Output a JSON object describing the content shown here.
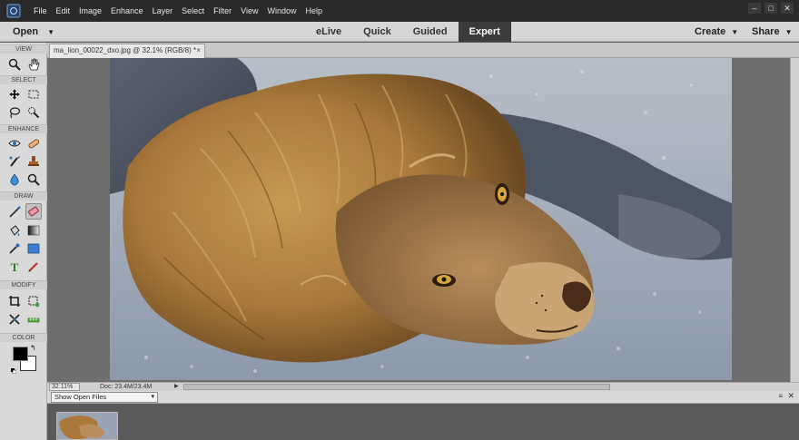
{
  "menubar": {
    "items": [
      "File",
      "Edit",
      "Image",
      "Enhance",
      "Layer",
      "Select",
      "Filter",
      "View",
      "Window",
      "Help"
    ],
    "logo_icon": "photoshop-elements-logo-icon",
    "window_controls": [
      "–",
      "□",
      "✕"
    ]
  },
  "modebar": {
    "open_label": "Open",
    "tabs": [
      "eLive",
      "Quick",
      "Guided",
      "Expert"
    ],
    "active_tab": "Expert",
    "create_label": "Create",
    "share_label": "Share"
  },
  "toolbox": {
    "sections": [
      "VIEW",
      "SELECT",
      "ENHANCE",
      "DRAW",
      "MODIFY",
      "COLOR"
    ],
    "tools": [
      "zoom-tool-icon",
      "hand-tool-icon",
      "move-tool-icon",
      "marquee-tool-icon",
      "lasso-tool-icon",
      "quick-selection-tool-icon",
      "red-eye-tool-icon",
      "spot-healing-tool-icon",
      "smart-brush-tool-icon",
      "clone-stamp-tool-icon",
      "blur-tool-icon",
      "sponge-tool-icon",
      "brush-tool-icon",
      "eraser-tool-icon",
      "paint-bucket-tool-icon",
      "gradient-tool-icon",
      "eyedropper-tool-icon",
      "shape-tool-icon",
      "type-tool-icon",
      "pencil-tool-icon",
      "crop-tool-icon",
      "recompose-tool-icon",
      "content-aware-move-tool-icon",
      "straighten-tool-icon"
    ],
    "selected_tool": "eraser-tool-icon",
    "foreground_color": "#000000",
    "background_color": "#ffffff"
  },
  "document": {
    "tab_title": "ma_lion_00022_dxo.jpg @ 32.1% (RGB/8) *",
    "close_glyph": "×"
  },
  "statusbar": {
    "zoom": "32.11%",
    "doc_info": "Doc: 23.4M/23.4M",
    "arrow": "▶"
  },
  "photo_bin": {
    "select_label": "Show Open Files",
    "menu_icon": "≡",
    "close_icon": "✕"
  },
  "colors": {
    "menubar_bg": "#2a2a2a",
    "modebar_bg": "#d6d6d6",
    "active_tab_bg": "#3b3b3b",
    "canvas_bg": "#6e6e6e"
  }
}
